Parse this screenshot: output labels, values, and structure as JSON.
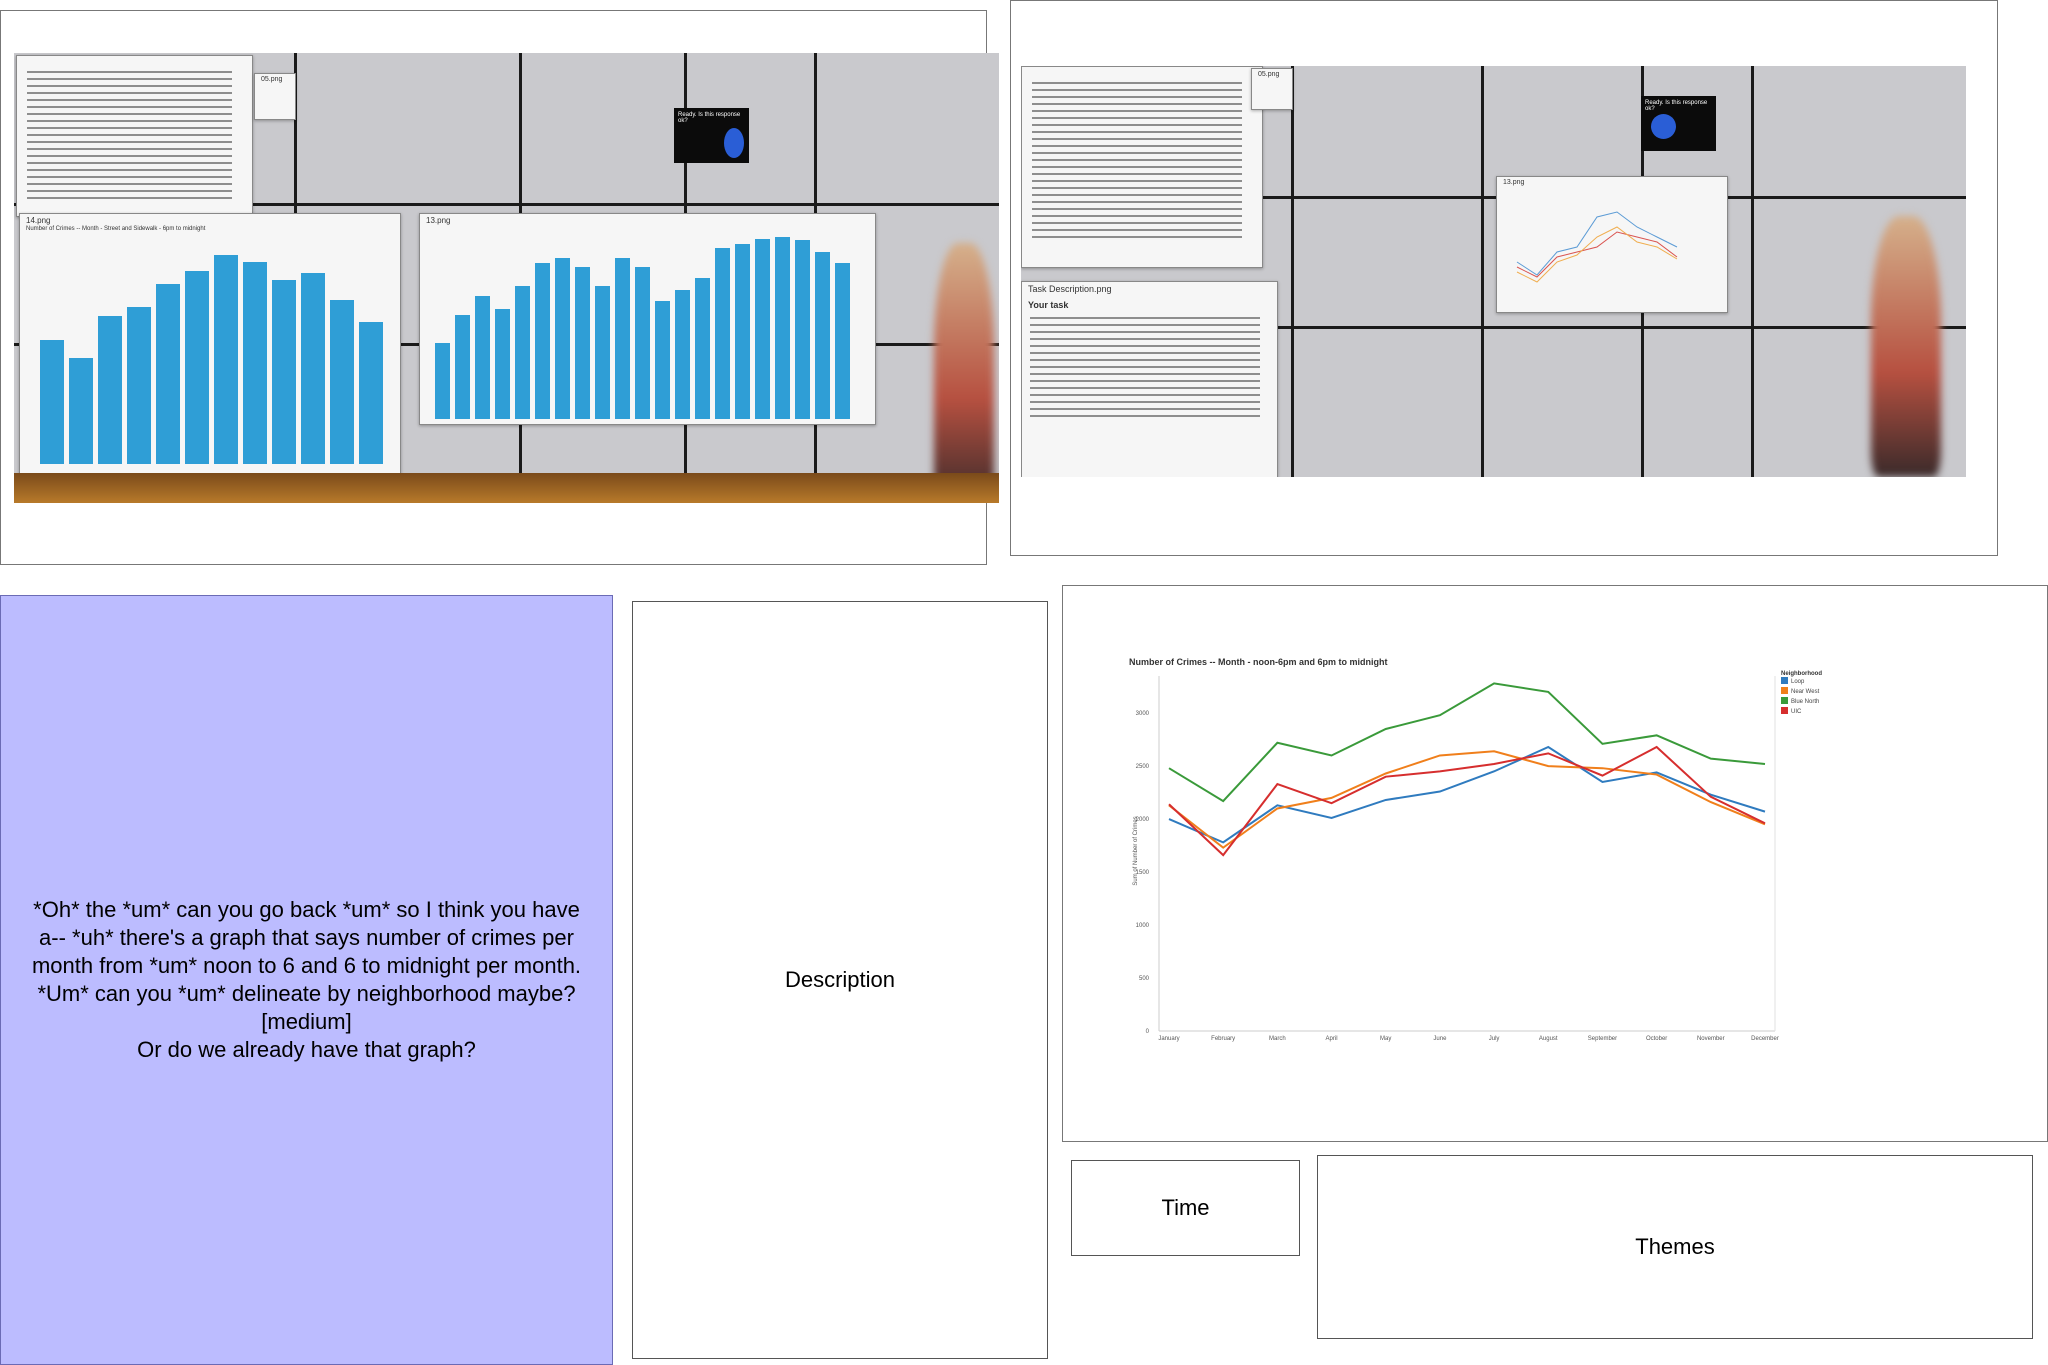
{
  "photo_left": {
    "win_14_title": "14.png",
    "win_14_chart_title": "Number of Crimes -- Month - Street and Sidewalk - 6pm to midnight",
    "win_13_title": "13.png",
    "win_ad_title": "05.png",
    "kiosk_text": "Ready. Is this response ok?",
    "bars_a": [
      0.55,
      0.47,
      0.66,
      0.7,
      0.8,
      0.86,
      0.93,
      0.9,
      0.82,
      0.85,
      0.73,
      0.63
    ],
    "bars_b": [
      0.4,
      0.55,
      0.65,
      0.58,
      0.7,
      0.82,
      0.85,
      0.8,
      0.7,
      0.85,
      0.8,
      0.62,
      0.68,
      0.74,
      0.9,
      0.92,
      0.95,
      0.96,
      0.94,
      0.88,
      0.82
    ]
  },
  "photo_right": {
    "task_title": "Task Description.png",
    "task_heading": "Your task",
    "win_ad_title": "05.png",
    "win_cp_title": "13.png",
    "kiosk_text": "Ready. Is this response ok?"
  },
  "speech": {
    "lines": [
      "*Oh* the *um* can you go back *um* so I think you have",
      "a-- *uh* there's a graph that says number of crimes per",
      "month from *um* noon to 6 and 6 to midnight per month.",
      "*Um* can you *um* delineate by neighborhood maybe?",
      "[medium]",
      "Or do we already have that graph?"
    ]
  },
  "labels": {
    "description": "Description",
    "time": "Time",
    "themes": "Themes"
  },
  "chart_data": {
    "type": "line",
    "title": "Number of Crimes -- Month - noon-6pm and 6pm to midnight",
    "xlabel": "",
    "ylabel": "Sum of Number of Crimes",
    "categories": [
      "January",
      "February",
      "March",
      "April",
      "May",
      "June",
      "July",
      "August",
      "September",
      "October",
      "November",
      "December"
    ],
    "yticks": [
      0,
      500,
      1000,
      1500,
      2000,
      2500,
      3000
    ],
    "ylim": [
      0,
      3350
    ],
    "legend_title": "Neighborhood",
    "legend_position": "top-right",
    "grid": false,
    "series": [
      {
        "name": "Loop",
        "color": "#2f7bbf",
        "values": [
          2000,
          1780,
          2130,
          2010,
          2180,
          2260,
          2450,
          2680,
          2350,
          2440,
          2230,
          2070
        ]
      },
      {
        "name": "Near West",
        "color": "#f07f1b",
        "values": [
          2130,
          1730,
          2100,
          2200,
          2430,
          2600,
          2640,
          2500,
          2480,
          2420,
          2160,
          1950
        ]
      },
      {
        "name": "Blue North",
        "color": "#3a9a3a",
        "values": [
          2480,
          2170,
          2720,
          2600,
          2850,
          2980,
          3280,
          3200,
          2710,
          2790,
          2570,
          2520
        ]
      },
      {
        "name": "UIC",
        "color": "#d62e2e",
        "values": [
          2140,
          1660,
          2330,
          2150,
          2400,
          2450,
          2520,
          2620,
          2410,
          2680,
          2210,
          1960
        ]
      }
    ]
  }
}
